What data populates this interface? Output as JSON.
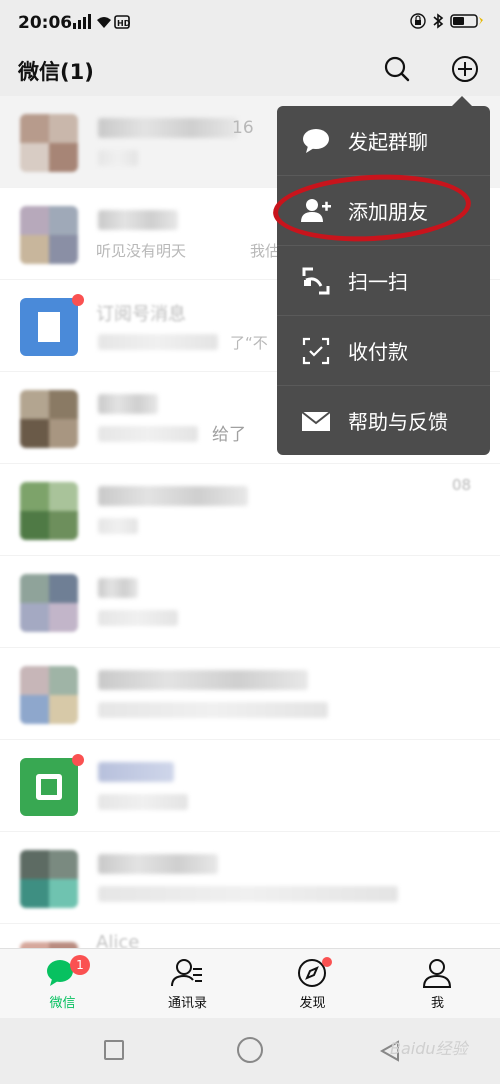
{
  "status_bar": {
    "time": "20:06"
  },
  "header": {
    "title": "微信(1)"
  },
  "chat_list": {
    "visible_fragments": [
      "16",
      "听见没有明天",
      "我估",
      "订阅号消息",
      "了“不",
      "给了",
      "08",
      "Alice"
    ]
  },
  "plus_menu": {
    "items": [
      {
        "label": "发起群聊",
        "icon": "chat-bubble-icon"
      },
      {
        "label": "添加朋友",
        "icon": "add-friend-icon"
      },
      {
        "label": "扫一扫",
        "icon": "scan-icon"
      },
      {
        "label": "收付款",
        "icon": "payment-icon"
      },
      {
        "label": "帮助与反馈",
        "icon": "mail-icon"
      }
    ]
  },
  "tab_bar": {
    "tabs": [
      {
        "label": "微信",
        "icon": "chats-icon",
        "badge": "1",
        "active": true
      },
      {
        "label": "通讯录",
        "icon": "contacts-icon",
        "active": false
      },
      {
        "label": "发现",
        "icon": "discover-icon",
        "active": false
      },
      {
        "label": "我",
        "icon": "me-icon",
        "active": false
      }
    ]
  },
  "watermark": "Baidu经验",
  "colors": {
    "accent": "#07c160",
    "badge": "#fa5151",
    "menu_bg": "#4c4c4c",
    "annotation": "#c8141c"
  }
}
